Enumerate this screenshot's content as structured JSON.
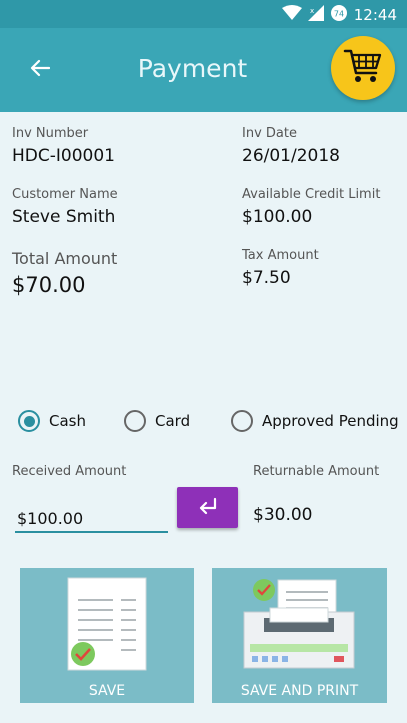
{
  "status_bar": {
    "time": "12:44",
    "badge": "74"
  },
  "app_bar": {
    "title": "Payment"
  },
  "invoice": {
    "inv_number_label": "Inv Number",
    "inv_number": "HDC-I00001",
    "inv_date_label": "Inv Date",
    "inv_date": "26/01/2018",
    "customer_name_label": "Customer Name",
    "customer_name": "Steve Smith",
    "credit_limit_label": "Available Credit Limit",
    "credit_limit": "$100.00",
    "total_amount_label": "Total Amount",
    "total_amount": "$70.00",
    "tax_amount_label": "Tax Amount",
    "tax_amount": "$7.50"
  },
  "payment_methods": [
    {
      "label": "Cash",
      "selected": true
    },
    {
      "label": "Card",
      "selected": false
    },
    {
      "label": "Approved Pending",
      "selected": false
    }
  ],
  "received": {
    "label": "Received Amount",
    "value": "$100.00"
  },
  "returnable": {
    "label": "Returnable Amount",
    "value": "$30.00"
  },
  "actions": {
    "save_label": "SAVE",
    "save_print_label": "SAVE AND PRINT"
  },
  "colors": {
    "header": "#3aa6b6",
    "status_bar": "#2f98a8",
    "accent": "#2a8fa0",
    "enter_button": "#8e30b8",
    "cart_button": "#f7c51a",
    "tile": "#7bbcc7"
  }
}
